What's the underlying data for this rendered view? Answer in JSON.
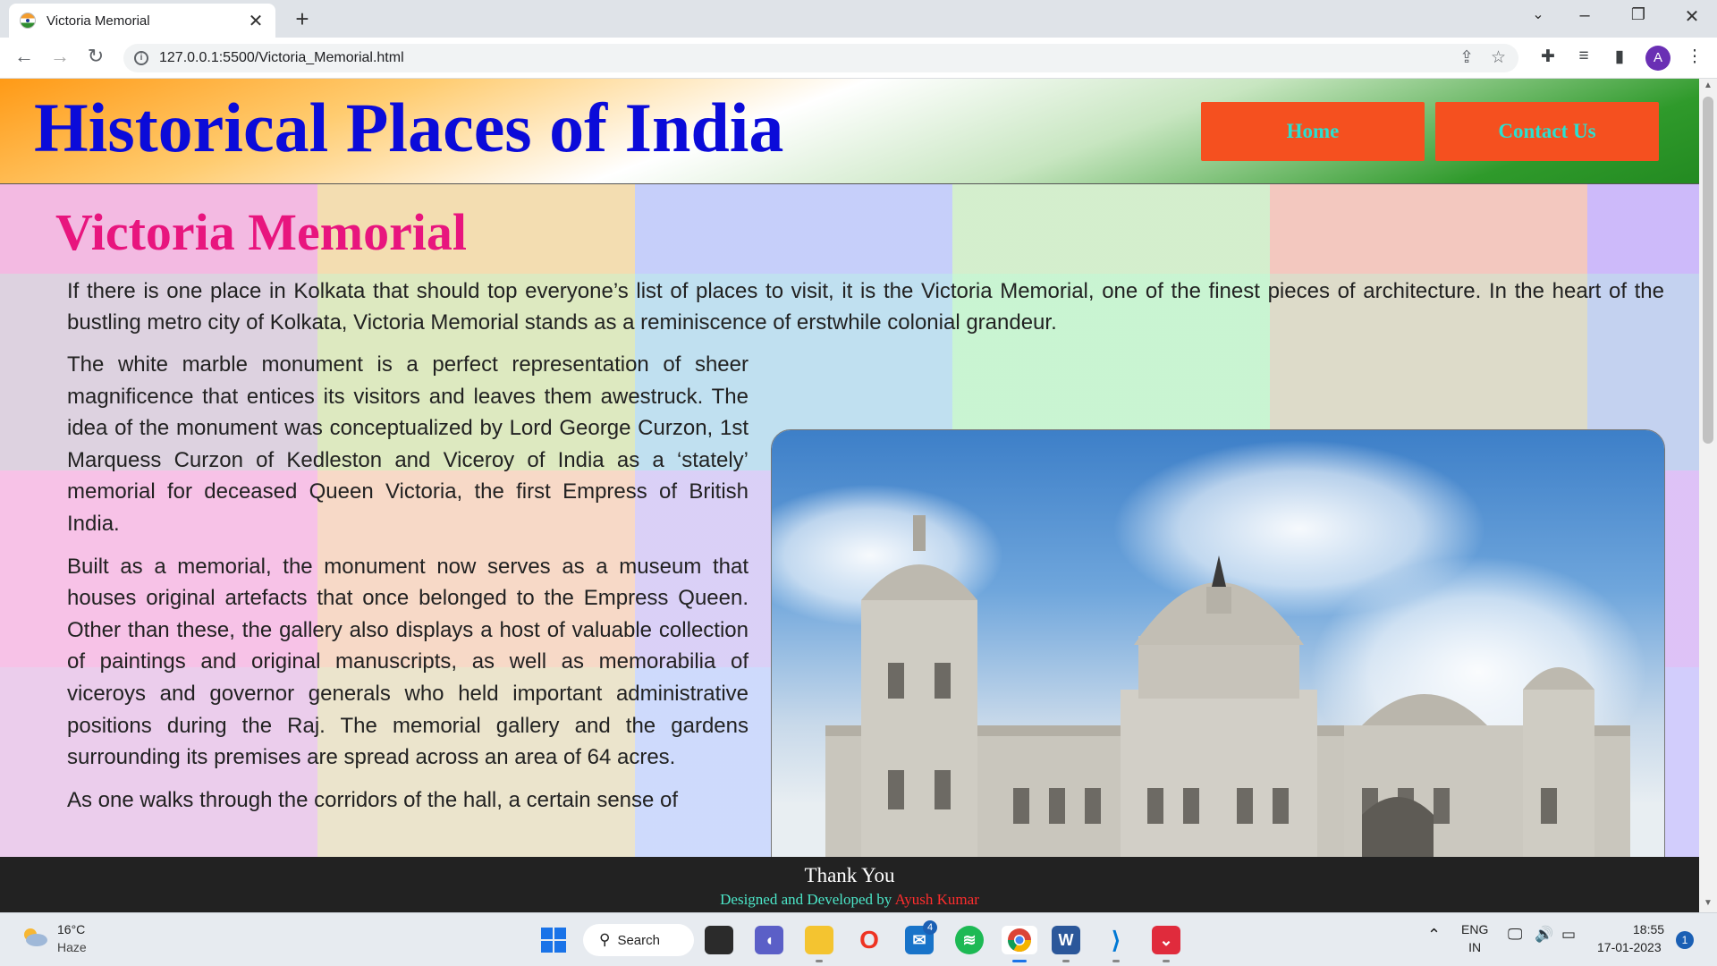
{
  "browser": {
    "tab_title": "Victoria Memorial",
    "url": "127.0.0.1:5500/Victoria_Memorial.html",
    "profile_initial": "A"
  },
  "site": {
    "title": "Historical Places of India",
    "nav": [
      {
        "label": "Home"
      },
      {
        "label": "Contact Us"
      }
    ]
  },
  "article": {
    "heading": "Victoria Memorial",
    "intro": "If there is one place in Kolkata that should top everyone’s list of places to visit, it is the Victoria Memorial, one of the finest pieces of architecture. In the heart of the bustling metro city of Kolkata, Victoria Memorial stands as a reminiscence of erstwhile colonial grandeur.",
    "paragraphs": [
      "The white marble monument is a perfect representation of sheer magnificence that entices its visitors and leaves them awestruck. The idea of the monument was conceptualized by Lord George Curzon, 1st Marquess Curzon of Kedleston and Viceroy of India as a ‘stately’ memorial for deceased Queen Victoria, the first Empress of British India.",
      "Built as a memorial, the monument now serves as a museum that houses original artefacts that once belonged to the Empress Queen. Other than these, the gallery also displays a host of valuable collection of paintings and original manuscripts, as well as memorabilia of viceroys and governor generals who held important administrative positions during the Raj. The memorial gallery and the gardens surrounding its premises are spread across an area of 64 acres.",
      "As one walks through the corridors of the hall, a certain sense of"
    ]
  },
  "footer": {
    "thanks": "Thank You",
    "credit_prefix": "Designed and Developed by",
    "credit_name": "Ayush Kumar"
  },
  "taskbar": {
    "weather_temp": "16°C",
    "weather_desc": "Haze",
    "search_label": "Search",
    "mail_badge": "4",
    "lang_top": "ENG",
    "lang_bottom": "IN",
    "time": "18:55",
    "date": "17-01-2023",
    "notifications": "1"
  },
  "colors": {
    "site_title": "#0b0bd9",
    "nav_button_bg": "#f5501f",
    "nav_button_text": "#2ae0d0",
    "heading": "#e8157e",
    "footer_bg": "#222222"
  }
}
